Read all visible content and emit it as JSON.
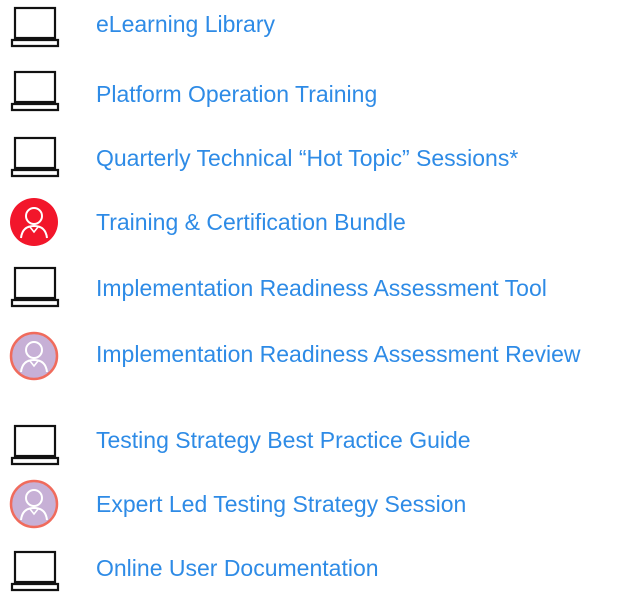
{
  "services": [
    {
      "label": "eLearning Library",
      "icon": "laptop-icon"
    },
    {
      "label": "Platform Operation Training",
      "icon": "laptop-icon"
    },
    {
      "label": "Quarterly Technical “Hot Topic” Sessions*",
      "icon": "laptop-icon"
    },
    {
      "label": "Training & Certification Bundle",
      "icon": "person-icon"
    },
    {
      "label": "Implementation Readiness Assessment Tool",
      "icon": "laptop-icon"
    },
    {
      "label": "Implementation Readiness Assessment Review",
      "icon": "person-icon"
    },
    {
      "label": "Testing Strategy Best Practice Guide",
      "icon": "laptop-icon"
    },
    {
      "label": "Expert Led Testing Strategy Session",
      "icon": "person-icon"
    },
    {
      "label": "Online User Documentation",
      "icon": "laptop-icon"
    }
  ],
  "colors": {
    "label": "#2e8be6",
    "laptop_stroke": "#111111",
    "person_red_fill": "#f2162b",
    "person_lilac_fill": "#c7b0d6",
    "person_ring": "#f06b5c"
  }
}
